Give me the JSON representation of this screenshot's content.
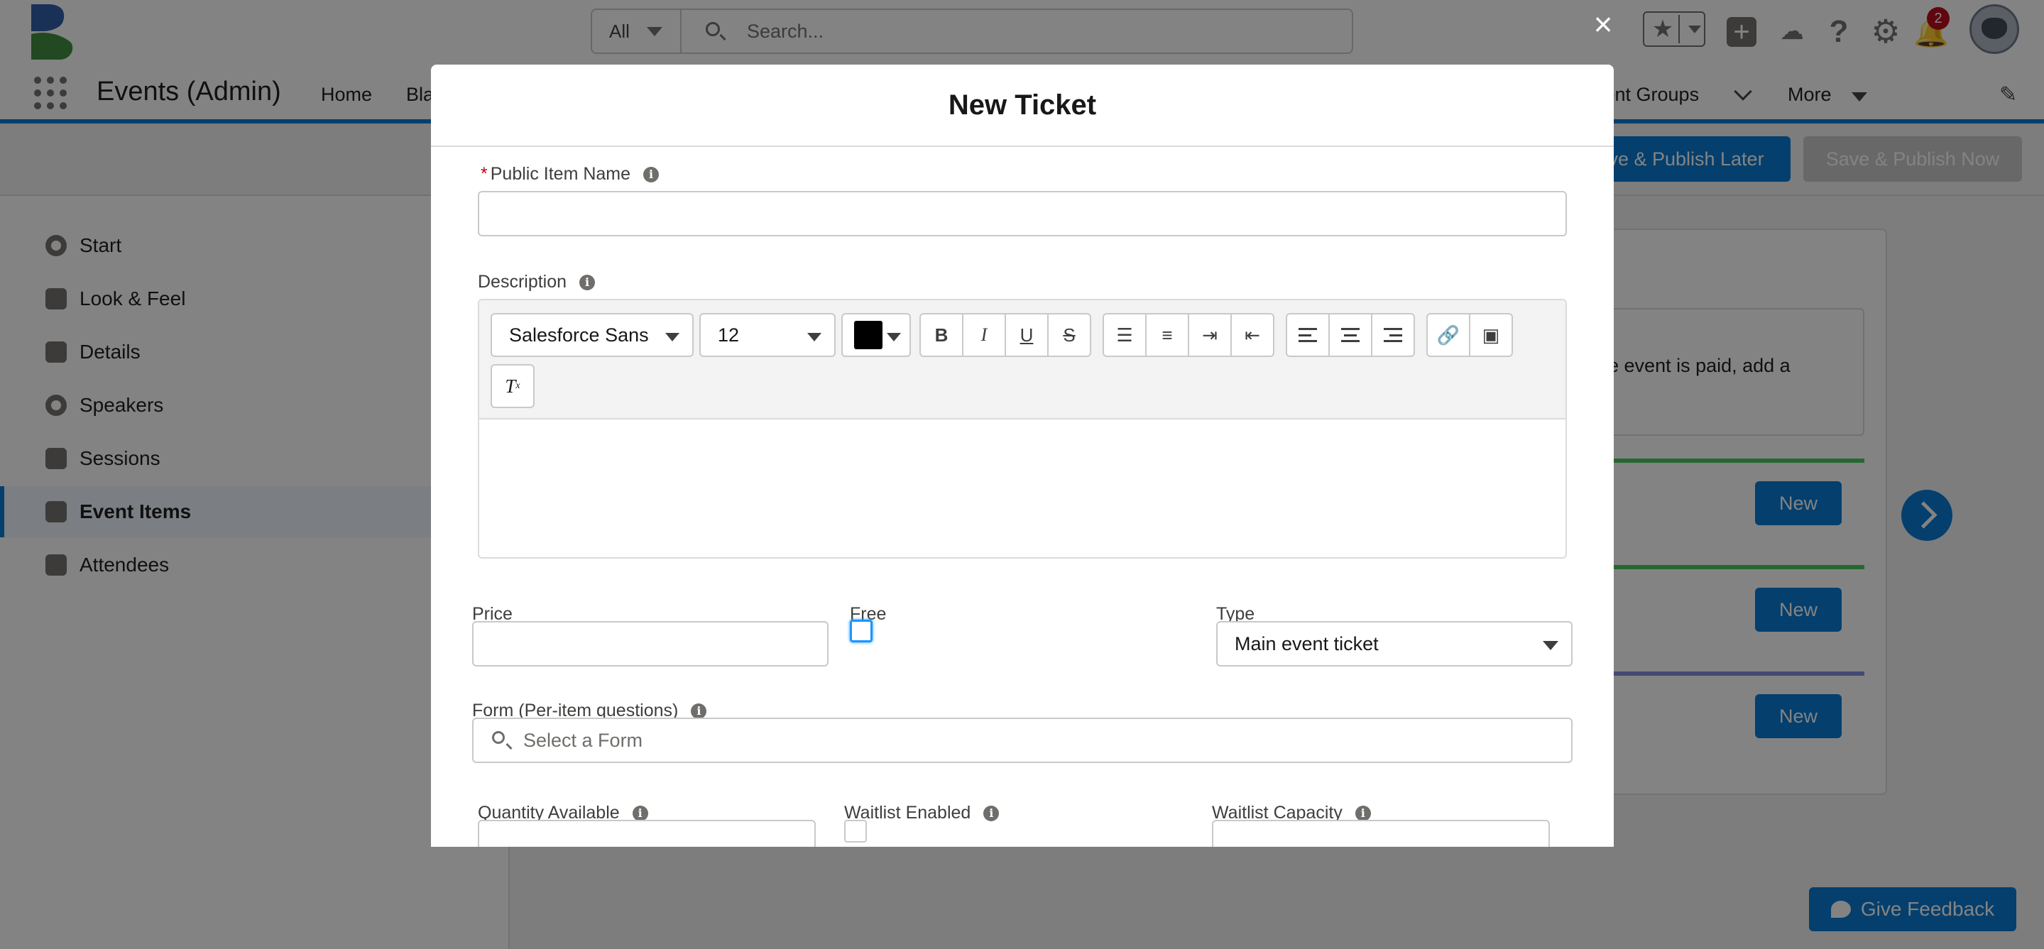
{
  "header": {
    "search": {
      "scope": "All",
      "placeholder": "Search..."
    },
    "notifications_count": "2"
  },
  "nav": {
    "app_name": "Events (Admin)",
    "items": [
      {
        "label": "Home"
      },
      {
        "label": "Bla"
      },
      {
        "label": "vent Groups"
      },
      {
        "label": "More"
      }
    ]
  },
  "actions": {
    "publish_later": "ve & Publish Later",
    "publish_now": "Save & Publish Now"
  },
  "sidebar": {
    "items": [
      {
        "label": "Start",
        "icon": "target-icon"
      },
      {
        "label": "Look & Feel",
        "icon": "brush-icon"
      },
      {
        "label": "Details",
        "icon": "details-icon"
      },
      {
        "label": "Speakers",
        "icon": "chat-icon"
      },
      {
        "label": "Sessions",
        "icon": "megaphone-icon"
      },
      {
        "label": "Event Items",
        "icon": "ticket-icon",
        "active": true
      },
      {
        "label": "Attendees",
        "icon": "people-icon"
      }
    ]
  },
  "content": {
    "info_text": "he event is paid, add a",
    "new_label": "New",
    "stripe_colors": [
      "#45c65a",
      "#45c65a",
      "#7f8de1"
    ]
  },
  "feedback": {
    "label": "Give Feedback"
  },
  "modal": {
    "title": "New Ticket",
    "close_symbol": "×",
    "public_item_name": {
      "label": "Public Item Name",
      "required_mark": "*",
      "value": ""
    },
    "description": {
      "label": "Description",
      "font": "Salesforce Sans",
      "size": "12",
      "text_color": "#000000"
    },
    "price": {
      "label": "Price",
      "value": ""
    },
    "free": {
      "label": "Free",
      "checked": false
    },
    "type": {
      "label": "Type",
      "value": "Main event ticket"
    },
    "form": {
      "label": "Form (Per-item questions)",
      "placeholder": "Select a Form"
    },
    "quantity": {
      "label": "Quantity Available"
    },
    "waitlist_enabled": {
      "label": "Waitlist Enabled"
    },
    "waitlist_capacity": {
      "label": "Waitlist Capacity"
    }
  },
  "colors": {
    "brand": "#0176d3",
    "disabled": "#c9c9c9",
    "required": "#ba0517"
  }
}
